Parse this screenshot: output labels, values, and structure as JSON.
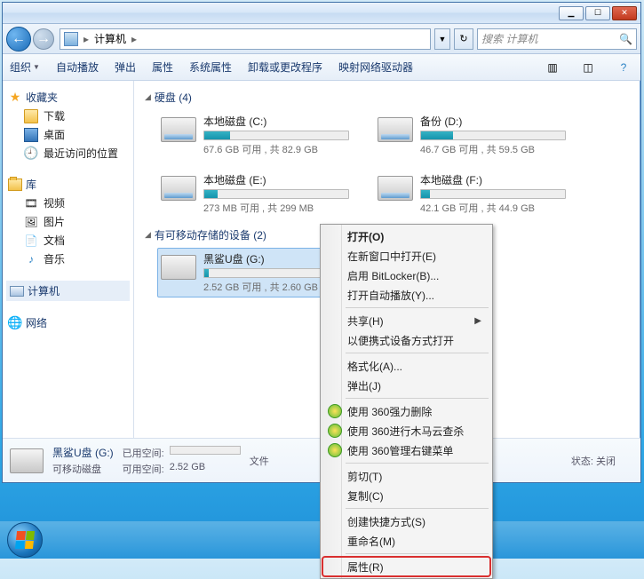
{
  "titlebar": {
    "min": "",
    "max": "",
    "close": ""
  },
  "address": {
    "root": "计算机",
    "sep": "▸"
  },
  "search": {
    "placeholder": "搜索 计算机"
  },
  "toolbar": {
    "organize": "组织",
    "autoplay": "自动播放",
    "eject": "弹出",
    "properties": "属性",
    "sysproperties": "系统属性",
    "uninstall": "卸载或更改程序",
    "mapdrive": "映射网络驱动器"
  },
  "sidebar": {
    "favorites": {
      "head": "收藏夹",
      "items": [
        "下载",
        "桌面",
        "最近访问的位置"
      ]
    },
    "libraries": {
      "head": "库",
      "items": [
        "视频",
        "图片",
        "文档",
        "音乐"
      ]
    },
    "computer": {
      "head": "计算机"
    },
    "network": {
      "head": "网络"
    }
  },
  "sections": {
    "hdd": {
      "label": "硬盘 (4)"
    },
    "removable": {
      "label": "有可移动存储的设备 (2)"
    }
  },
  "drives": {
    "c": {
      "name": "本地磁盘 (C:)",
      "free": "67.6 GB 可用 , 共 82.9 GB",
      "pct": 18
    },
    "d": {
      "name": "备份 (D:)",
      "free": "46.7 GB 可用 , 共 59.5 GB",
      "pct": 22
    },
    "e": {
      "name": "本地磁盘 (E:)",
      "free": "273 MB 可用 , 共 299 MB",
      "pct": 9
    },
    "f": {
      "name": "本地磁盘 (F:)",
      "free": "42.1 GB 可用 , 共 44.9 GB",
      "pct": 6
    },
    "g": {
      "name": "黑鲨U盘 (G:)",
      "free": "2.52 GB 可用 , 共 2.60 GB",
      "pct": 3
    }
  },
  "details": {
    "name": "黑鲨U盘 (G:)",
    "type": "可移动磁盘",
    "usedlbl": "已用空间:",
    "freelbl": "可用空间:",
    "freeval": "2.52 GB",
    "filelbl": "文件",
    "statuslbl": "状态:  关闭"
  },
  "context": {
    "open": "打开(O)",
    "newwin": "在新窗口中打开(E)",
    "bitlocker": "启用 BitLocker(B)...",
    "autoplay": "打开自动播放(Y)...",
    "share": "共享(H)",
    "portable": "以便携式设备方式打开",
    "format": "格式化(A)...",
    "eject": "弹出(J)",
    "del360": "使用 360强力删除",
    "trojan360": "使用 360进行木马云查杀",
    "menu360": "使用 360管理右键菜单",
    "cut": "剪切(T)",
    "copy": "复制(C)",
    "shortcut": "创建快捷方式(S)",
    "rename": "重命名(M)",
    "properties": "属性(R)"
  }
}
